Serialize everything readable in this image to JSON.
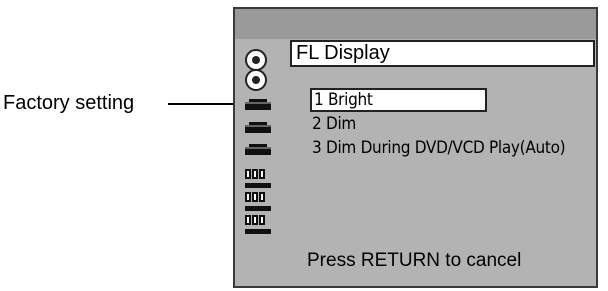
{
  "callout": {
    "label": "Factory setting"
  },
  "menu": {
    "title": "FL Display",
    "items": [
      {
        "label": "1 Bright",
        "selected": true
      },
      {
        "label": "2 Dim",
        "selected": false
      },
      {
        "label": "3 Dim During DVD/VCD Play(Auto)",
        "selected": false
      }
    ],
    "footer": "Press RETURN to cancel"
  },
  "sidebar_icons": [
    "disc-icon",
    "disc-icon",
    "device-icon",
    "device-icon",
    "device-icon",
    "speaker-icon",
    "speaker-icon",
    "speaker-icon"
  ],
  "colors": {
    "panel_bg": "#b3b3b3",
    "topbar_bg": "#9a9a9a",
    "highlight_bg": "#ffffff"
  }
}
